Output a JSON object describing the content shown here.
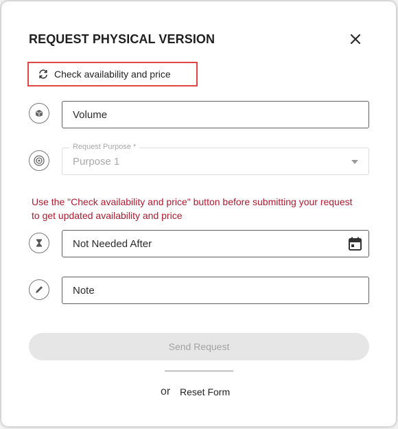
{
  "dialog": {
    "title": "REQUEST PHYSICAL VERSION",
    "check_availability_label": "Check availability and price",
    "fields": {
      "volume_placeholder": "Volume",
      "request_purpose_label": "Request Purpose *",
      "request_purpose_value": "Purpose 1",
      "not_needed_after_placeholder": "Not Needed After",
      "note_placeholder": "Note"
    },
    "warning": "Use the \"Check availability and price\" button before submitting your request to get updated availability and price",
    "send_button": "Send Request",
    "or_text": "or",
    "reset_link": "Reset Form"
  },
  "colors": {
    "warning_text": "#b0192e",
    "highlight_border": "#e24444",
    "disabled_button_bg": "#e6e6e6"
  },
  "icons": [
    "close-icon",
    "refresh-icon",
    "cube-icon",
    "target-icon",
    "hourglass-icon",
    "calendar-icon",
    "pencil-icon",
    "caret-down-icon"
  ]
}
